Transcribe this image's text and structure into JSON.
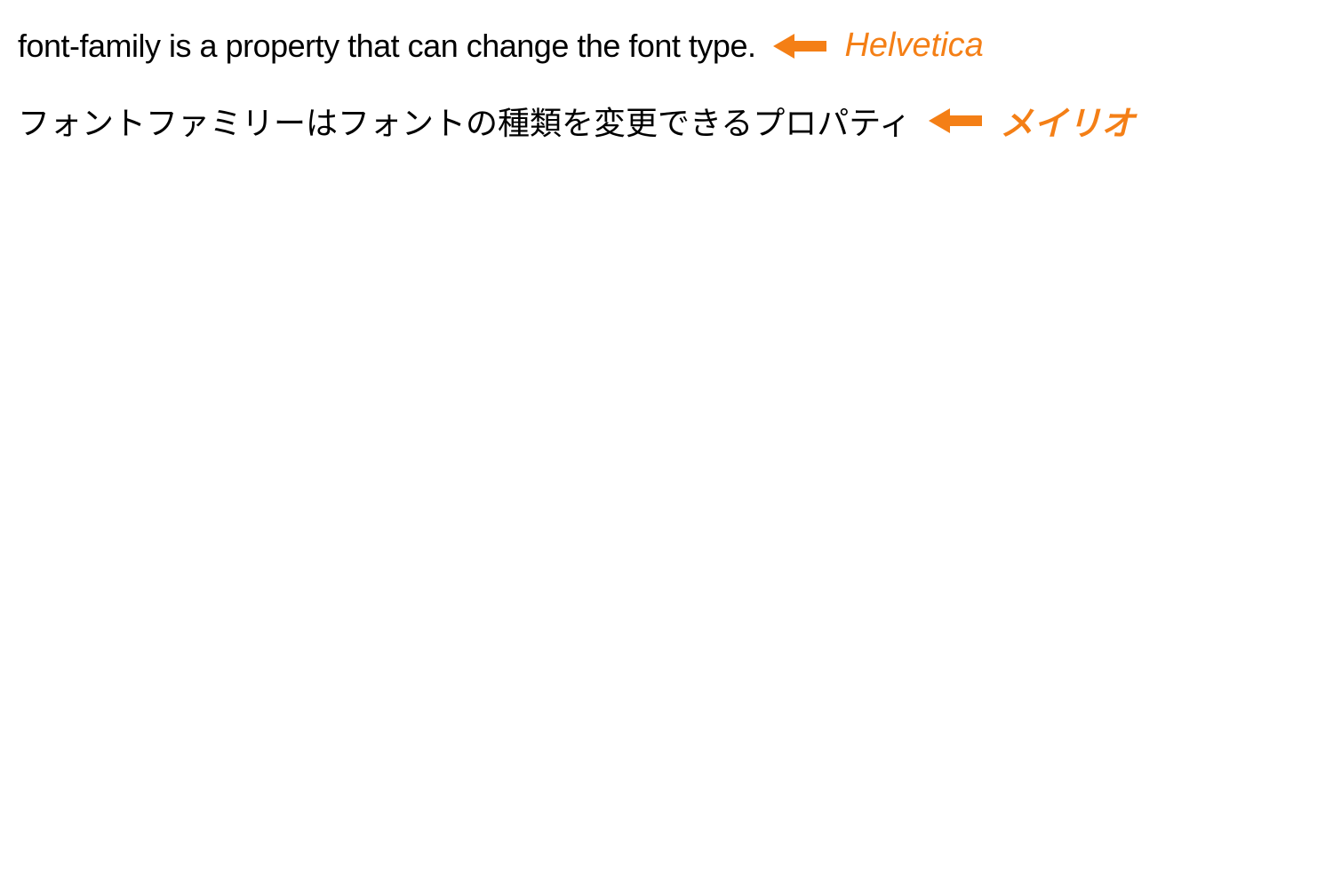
{
  "colors": {
    "accent": "#f47f16"
  },
  "rows": [
    {
      "text": "font-family is a property that can change the font type.",
      "label": "Helvetica"
    },
    {
      "text": "フォントファミリーはフォントの種類を変更できるプロパティ",
      "label": "メイリオ"
    }
  ]
}
